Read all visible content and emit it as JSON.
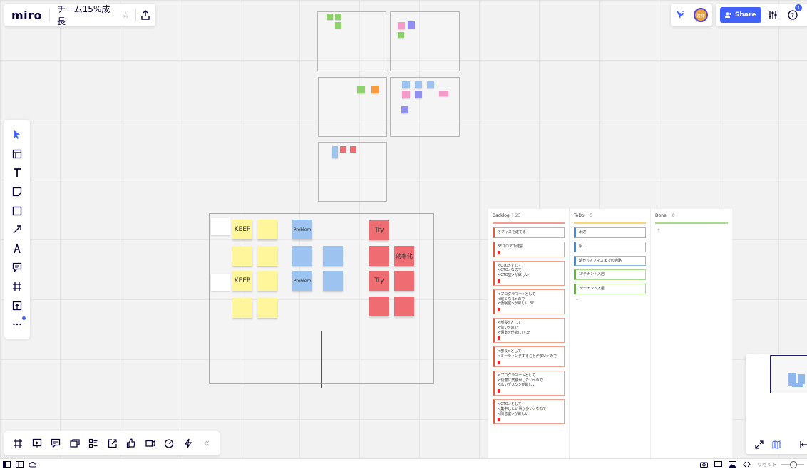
{
  "app": {
    "logo": "miro",
    "board_title": "チーム15%成長",
    "share_label": "Share",
    "help_count": "3",
    "avatar_text": "佐藤"
  },
  "colors": {
    "accent": "#4262ff",
    "sticky_yellow": "#fff59b",
    "sticky_blue": "#9dc4f0",
    "sticky_red": "#ef6c72",
    "sticky_green": "#8fd16a",
    "sticky_violet": "#8f8ff5",
    "sticky_pink": "#f49bc8",
    "sticky_orange": "#f79b3b"
  },
  "left_toolbar": [
    "select-icon",
    "templates-icon",
    "text-icon",
    "sticky-note-icon",
    "shape-icon",
    "connector-icon",
    "pen-icon",
    "comment-icon",
    "frame-icon",
    "upload-icon",
    "more-tools-icon"
  ],
  "bottom_toolbar": [
    "frames-icon",
    "presentation-icon",
    "comments-icon",
    "cards-icon",
    "list-icon",
    "share-screen-icon",
    "voting-icon",
    "video-chat-icon",
    "timer-icon",
    "integrations-icon",
    "collapse-icon"
  ],
  "status_bar": {
    "zoom_label": "リセット"
  },
  "retro": {
    "keep1": "KEEP",
    "keep2": "KEEP",
    "problem1": "Problem",
    "problem2": "Problem",
    "try1": "Try",
    "try2": "Try",
    "efficiency": "効率化"
  },
  "kanban": {
    "columns": [
      {
        "title": "Backlog",
        "count": "23",
        "cards": [
          {
            "text": "オフィスを建てる",
            "tag": false
          },
          {
            "text": "3Fフロアの建設",
            "tag": true
          },
          {
            "text": "<CTO>として\n<CTO>なので\n<CTO室>が欲しい",
            "tag": true
          },
          {
            "text": "<プログラマー>として\n<眠くなる>ので\n<仮眠室>が欲しい 3F",
            "tag": true
          },
          {
            "text": "<部長>として\n<偉い>ので\n<個室>が欲しい 3F",
            "tag": true
          },
          {
            "text": "<部長>として\n<ミーティングすることが多い>ので",
            "tag": true
          },
          {
            "text": "<プログラマー>として\n<快適に業務がしたい>ので\n<広いデスク>が欲しい",
            "tag": true
          },
          {
            "text": "<CTO>として\n<集中したい事が多い>なので\n<防音室>が欲しい",
            "tag": true
          }
        ]
      },
      {
        "title": "ToDo",
        "count": "5",
        "cards": [
          {
            "text": "水辺",
            "color": "blue"
          },
          {
            "text": "駅",
            "color": "blue"
          },
          {
            "text": "駅からオフィスまでの通路",
            "color": "blue"
          },
          {
            "text": "1Fテナント入居",
            "color": "green"
          },
          {
            "text": "2Fテナント入居",
            "color": "green"
          }
        ]
      },
      {
        "title": "Done",
        "count": "0",
        "cards": []
      }
    ]
  }
}
